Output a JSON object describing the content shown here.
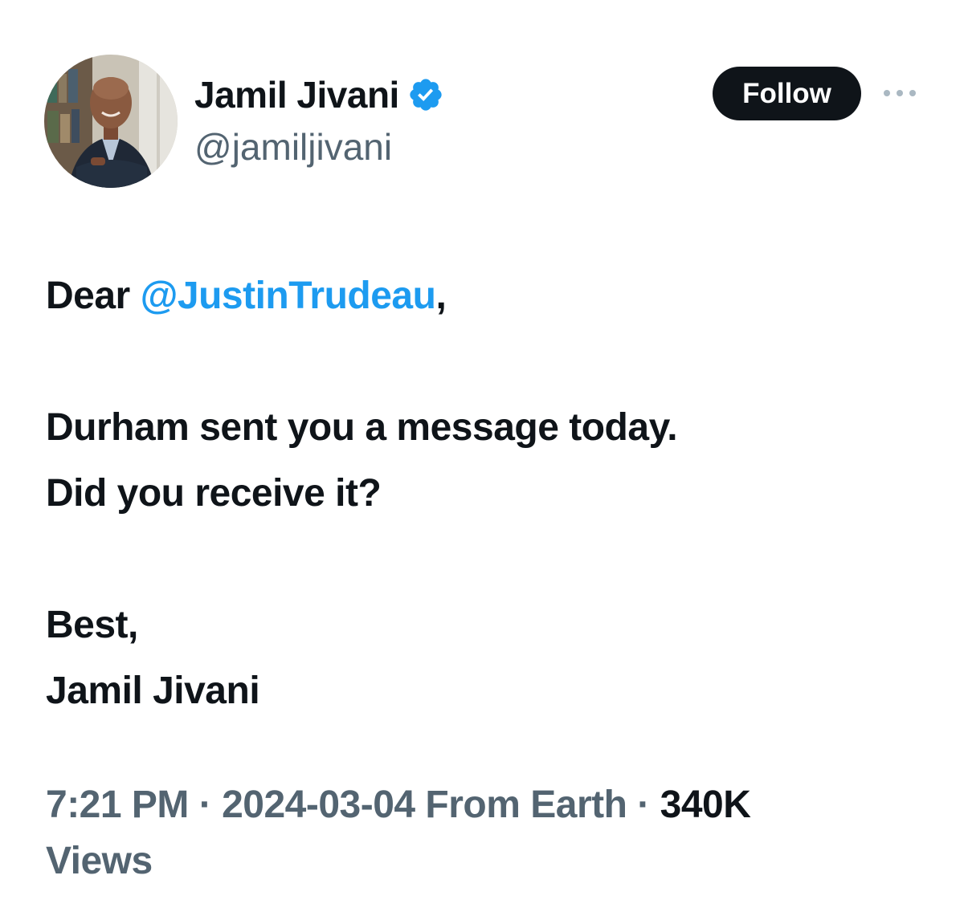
{
  "author": {
    "display_name": "Jamil Jivani",
    "handle": "@jamiljivani",
    "verified": true
  },
  "actions": {
    "follow_label": "Follow"
  },
  "tweet": {
    "greeting_prefix": "Dear ",
    "mention": "@JustinTrudeau",
    "greeting_suffix": ",",
    "line_2": "Durham sent you a message today.",
    "line_3": "Did you receive it?",
    "line_4": "Best,",
    "line_5": "Jamil Jivani"
  },
  "meta": {
    "time": "7:21 PM",
    "separator_1": " · ",
    "date": "2024-03-04",
    "source": " From Earth",
    "separator_2": " · ",
    "views_count": "340K",
    "views_label": "Views"
  },
  "colors": {
    "link": "#1d9bf0",
    "verified": "#1d9bf0",
    "text_primary": "#0f1419",
    "text_secondary": "#536471",
    "button_bg": "#0f1419"
  },
  "icons": {
    "verified": "verified-badge-icon",
    "more": "more-horizontal-icon"
  }
}
